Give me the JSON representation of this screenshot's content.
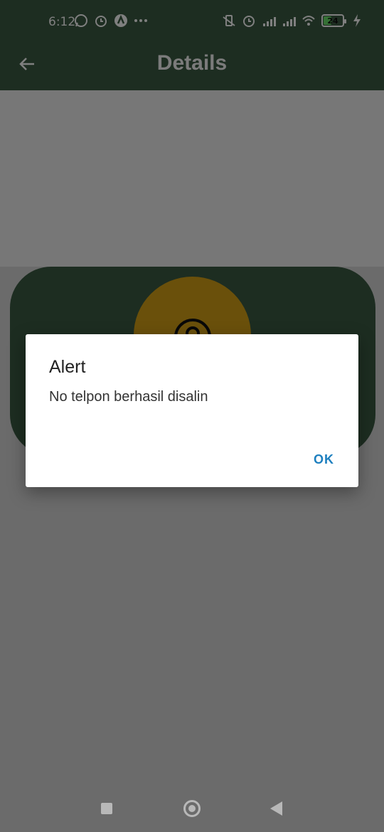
{
  "status_bar": {
    "time": "6:12",
    "battery": "24",
    "left_icons": [
      "whatsapp-icon",
      "alarm-icon",
      "app-icon",
      "more-dots-icon"
    ],
    "right_icons": [
      "vibrate-icon",
      "alarm-icon",
      "signal-4g-icon",
      "signal-icon",
      "wifi-icon",
      "battery-icon",
      "charging-icon"
    ]
  },
  "app_bar": {
    "title": "Details"
  },
  "dialog": {
    "title": "Alert",
    "message": "No telpon berhasil disalin",
    "ok_label": "OK"
  },
  "colors": {
    "primary": "#3a5a42",
    "avatar": "#d4a017",
    "dialog_button": "#1d7fbf"
  }
}
